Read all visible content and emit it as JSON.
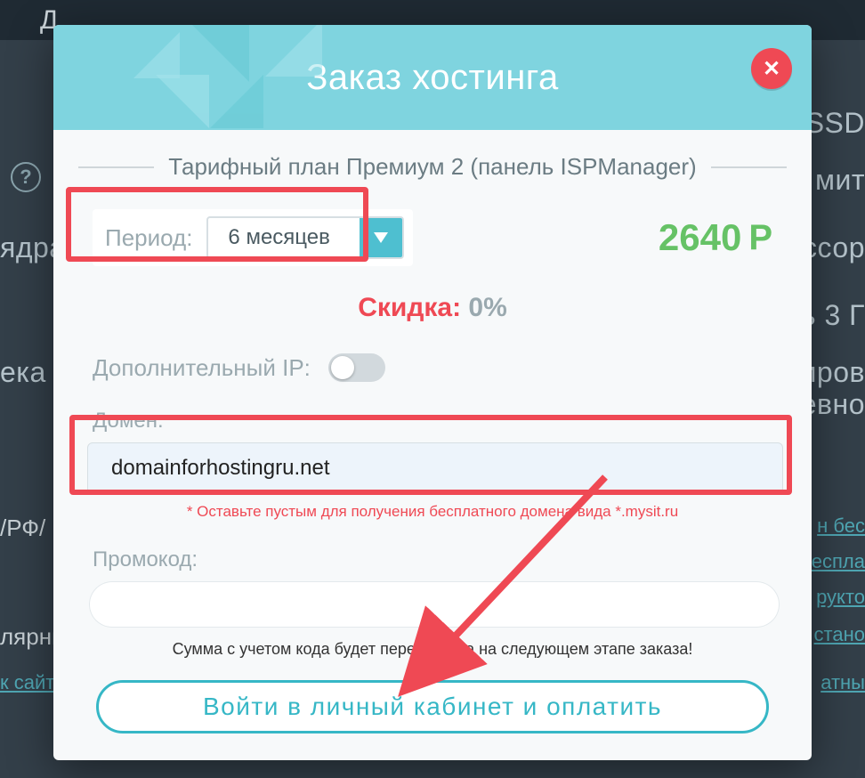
{
  "background": {
    "top_left": "Д",
    "ssd": "SSD",
    "mit": "мит",
    "yadra": "ядра",
    "ccop": "ссор",
    "three": "ь 3 Г",
    "eka": "ека",
    "irov": "иров",
    "evn": "евно",
    "rf": "/РФ/",
    "bes": "н бес",
    "espla": "еспла",
    "rukto": "рукто",
    "lyarn": "лярны",
    "stano": "стано",
    "sayt": "к сайт",
    "atn": "атны",
    "help": "?"
  },
  "modal": {
    "title": "Заказ хостинга",
    "plan": "Тарифный план Премиум 2 (панель ISPManager)",
    "period_label": "Период:",
    "period_value": "6 месяцев",
    "price": "2640",
    "currency": "Р",
    "discount_label": "Скидка:",
    "discount_value": " 0%",
    "ip_label": "Дополнительный IP:",
    "domain_label": "Домен:",
    "domain_value": "domainforhostingru.net",
    "domain_hint": "* Оставьте пустым для получения бесплатного домена вида *.mysit.ru",
    "promo_label": "Промокод:",
    "promo_hint": "Сумма с учетом кода будет пересчитана на следующем этапе заказа!",
    "pay_button": "Войти в личный кабинет и оплатить"
  }
}
